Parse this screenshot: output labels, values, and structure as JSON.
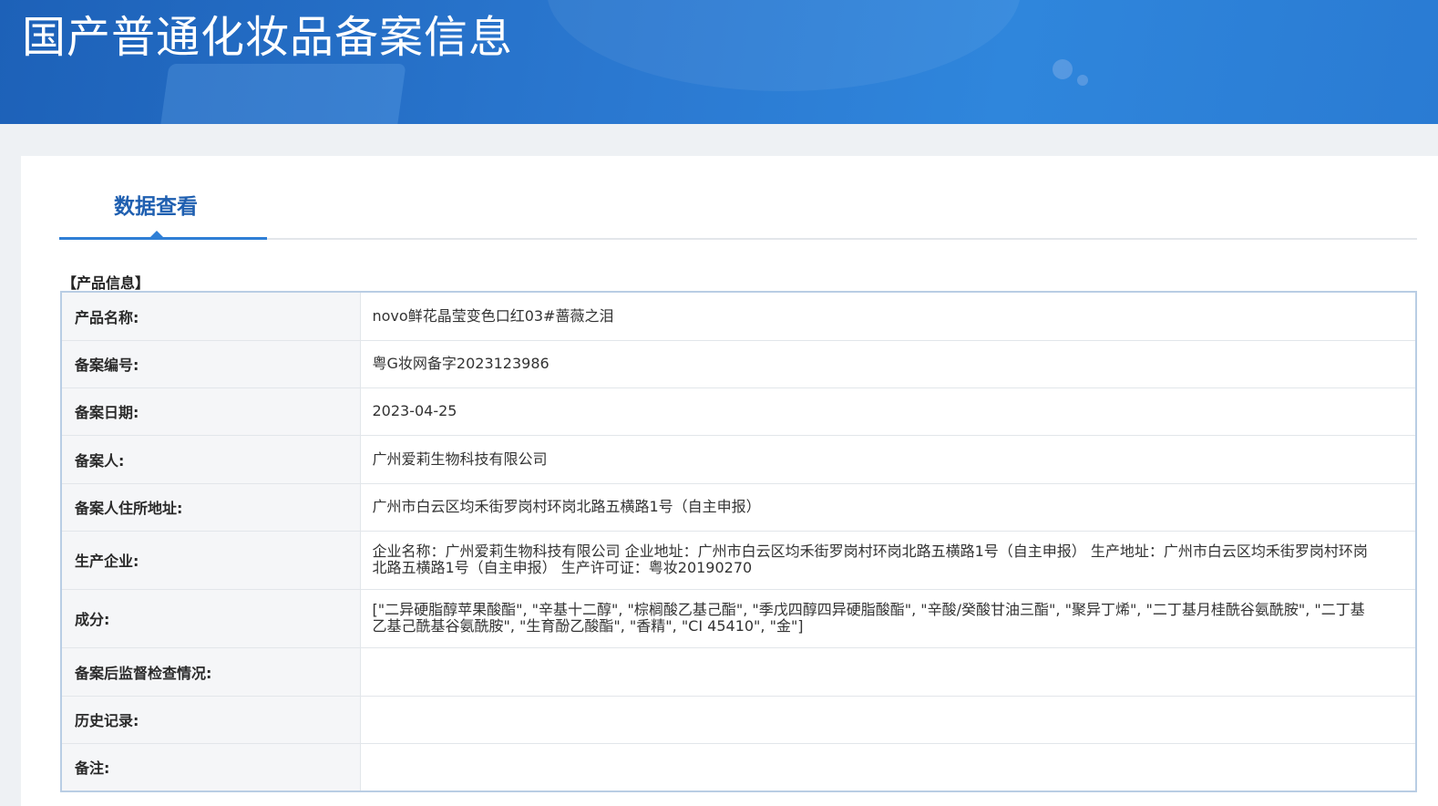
{
  "header": {
    "title": "国产普通化妆品备案信息"
  },
  "tabs": [
    {
      "label": "数据查看"
    }
  ],
  "section": {
    "title": "【产品信息】"
  },
  "rows": [
    {
      "label": "产品名称:",
      "value": "novo鲜花晶莹变色口红03#蔷薇之泪"
    },
    {
      "label": "备案编号:",
      "value": "粤G妆网备字2023123986"
    },
    {
      "label": "备案日期:",
      "value": "2023-04-25"
    },
    {
      "label": "备案人:",
      "value": "广州爱莉生物科技有限公司"
    },
    {
      "label": "备案人住所地址:",
      "value": "广州市白云区均禾街罗岗村环岗北路五横路1号（自主申报）"
    },
    {
      "label": "生产企业:",
      "value": "企业名称：广州爱莉生物科技有限公司 企业地址：广州市白云区均禾街罗岗村环岗北路五横路1号（自主申报） 生产地址：广州市白云区均禾街罗岗村环岗北路五横路1号（自主申报） 生产许可证：粤妆20190270"
    },
    {
      "label": "成分:",
      "value": "[\"二异硬脂醇苹果酸酯\", \"辛基十二醇\", \"棕榈酸乙基己酯\", \"季戊四醇四异硬脂酸酯\", \"辛酸/癸酸甘油三酯\", \"聚异丁烯\", \"二丁基月桂酰谷氨酰胺\", \"二丁基乙基己酰基谷氨酰胺\", \"生育酚乙酸酯\", \"香精\", \"CI 45410\", \"金\"]"
    },
    {
      "label": "备案后监督检查情况:",
      "value": ""
    },
    {
      "label": "历史记录:",
      "value": ""
    },
    {
      "label": "备注:",
      "value": ""
    }
  ]
}
